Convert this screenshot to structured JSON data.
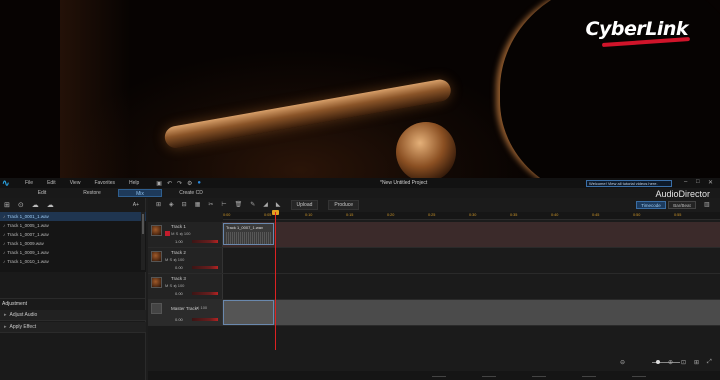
{
  "brand": {
    "name": "CyberLink"
  },
  "menubar": {
    "items": [
      "File",
      "Edit",
      "View",
      "Favorites",
      "Help"
    ],
    "project_title": "*New Untitled Project",
    "welcome_text": "Welcome! View all tutorial videos here.",
    "window_controls": [
      "–",
      "□",
      "✕"
    ]
  },
  "tabs": {
    "items": [
      "Edit",
      "Restore",
      "Mix",
      "Create CD"
    ],
    "active": "Mix",
    "app_name": "AudioDirector"
  },
  "left_panel": {
    "font_size_label": "A+",
    "media_items": [
      "Track 1_0001_1.wav",
      "Track 1_0005_1.wav",
      "Track 1_0007_1.wav",
      "Track 1_0009.wav",
      "Track 1_0009_1.wav",
      "Track 1_0010_1.wav"
    ],
    "selected_index": 0,
    "adjustment_title": "Adjustment",
    "adjust_rows": [
      "Adjust Audio",
      "Apply Effect"
    ]
  },
  "timeline": {
    "toolbar_buttons": [
      "Upload",
      "Produce"
    ],
    "timecode_label": "Timecode",
    "barbeat_label": "Bar/Beat",
    "ruler_ticks": [
      "0:00",
      "0:05",
      "0:10",
      "0:15",
      "0:20",
      "0:25",
      "0:30",
      "0:35",
      "0:40",
      "0:45",
      "0:50",
      "0:55"
    ],
    "tracks": [
      {
        "name": "Track 1",
        "volume": "1.00",
        "clip": "Track 1_0007_1.wav",
        "mute": "M",
        "solo": "S",
        "gain": "100"
      },
      {
        "name": "Track 2",
        "volume": "0.00",
        "clip": "",
        "mute": "M",
        "solo": "S",
        "gain": "100"
      },
      {
        "name": "Track 3",
        "volume": "0.00",
        "clip": "",
        "mute": "M",
        "solo": "S",
        "gain": "100"
      },
      {
        "name": "Master Track",
        "volume": "0.00",
        "clip": "",
        "mute": "M",
        "solo": "S",
        "gain": "100"
      }
    ]
  },
  "colors": {
    "accent": "#2a8be0",
    "playhead": "#d22222",
    "record": "#c21c2c",
    "brand_red": "#d0142a"
  }
}
